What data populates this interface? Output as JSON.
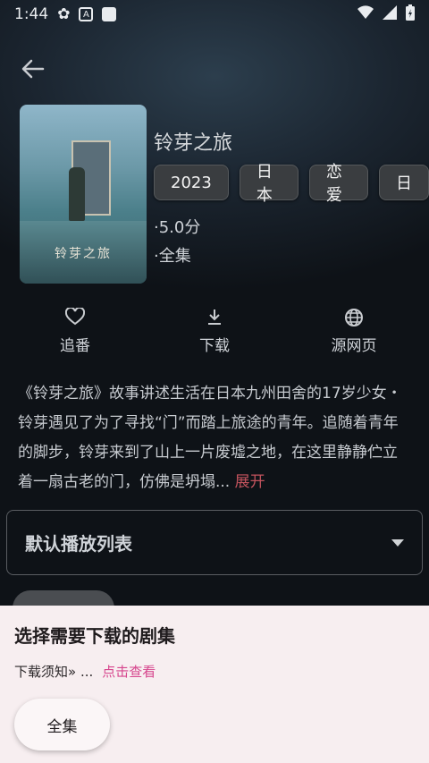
{
  "status": {
    "time": "1:44",
    "notif_letter": "A"
  },
  "detail": {
    "title": "铃芽之旅",
    "tags": [
      "2023",
      "日本",
      "恋爱",
      "日"
    ],
    "rating": "·5.0分",
    "episodes": "·全集",
    "poster_text": "铃芽之旅"
  },
  "actions": [
    {
      "label": "追番",
      "icon": "heart-icon"
    },
    {
      "label": "下载",
      "icon": "download-icon"
    },
    {
      "label": "源网页",
      "icon": "globe-icon"
    }
  ],
  "description": {
    "text": "《铃芽之旅》故事讲述生活在日本九州田舍的17岁少女・铃芽遇见了为了寻找“门”而踏上旅途的青年。追随着青年的脚步，铃芽来到了山上一片废墟之地，在这里静静伫立着一扇古老的门，仿佛是坍塌...",
    "expand_label": "展开"
  },
  "playlist": {
    "label": "默认播放列表"
  },
  "sheet": {
    "title": "选择需要下载的剧集",
    "notice": "下载须知» ...",
    "notice_link": "点击查看",
    "chip_label": "全集"
  },
  "colors": {
    "accent_link": "#d6458d",
    "expand": "#c2535d",
    "sheet_bg": "#f7eef0"
  }
}
